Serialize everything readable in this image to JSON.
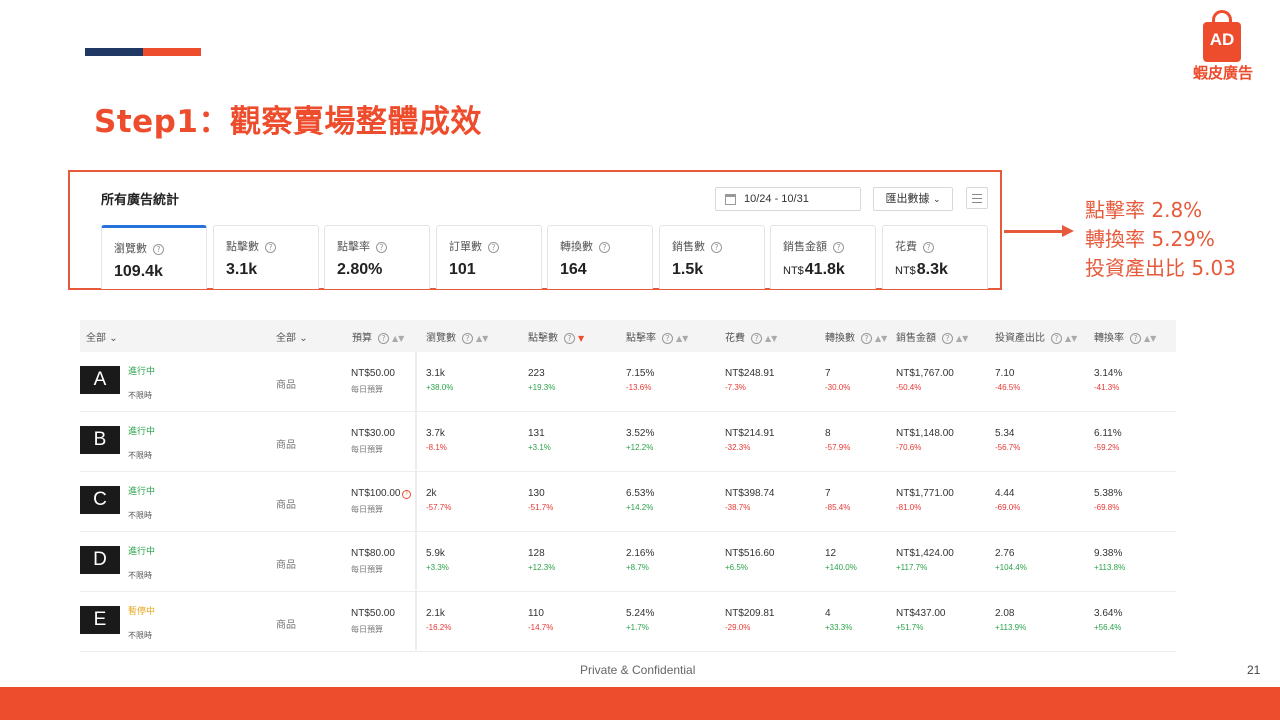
{
  "slide": {
    "title": "Step1：觀察賣場整體成效",
    "logo_ad": "AD",
    "logo_text": "蝦皮廣告",
    "footer": "Private & Confidential",
    "page": "21",
    "accent_color": "#ee4d2d",
    "navy_color": "#1f3864"
  },
  "stats": {
    "title": "所有廣告統計",
    "date_range": "10/24 - 10/31",
    "export_label": "匯出數據",
    "metrics": [
      {
        "label": "瀏覽數",
        "prefix": "",
        "value": "109.4k"
      },
      {
        "label": "點擊數",
        "prefix": "",
        "value": "3.1k"
      },
      {
        "label": "點擊率",
        "prefix": "",
        "value": "2.80%"
      },
      {
        "label": "訂單數",
        "prefix": "",
        "value": "101"
      },
      {
        "label": "轉換數",
        "prefix": "",
        "value": "164"
      },
      {
        "label": "銷售數",
        "prefix": "",
        "value": "1.5k"
      },
      {
        "label": "銷售金額",
        "prefix": "NT$",
        "value": "41.8k"
      },
      {
        "label": "花費",
        "prefix": "NT$",
        "value": "8.3k"
      }
    ]
  },
  "callout": {
    "line1": "點擊率 2.8%",
    "line2": "轉換率 5.29%",
    "line3": "投資產出比 5.03"
  },
  "table": {
    "headers": {
      "all1": "全部",
      "all2": "全部",
      "budget": "預算",
      "views": "瀏覽數",
      "clicks": "點擊數",
      "ctr": "點擊率",
      "spend": "花費",
      "conversions": "轉換數",
      "sales": "銷售金額",
      "roas": "投資產出比",
      "cvr": "轉換率"
    },
    "rows": [
      {
        "letter": "A",
        "status": "進行中",
        "duration": "不限時",
        "type": "商品",
        "budget": "NT$50.00",
        "budget_note": "每日預算",
        "views": "3.1k",
        "views_d": "+38.0%",
        "clicks": "223",
        "clicks_d": "+19.3%",
        "ctr": "7.15%",
        "ctr_d": "-13.6%",
        "spend": "NT$248.91",
        "spend_d": "-7.3%",
        "conv": "7",
        "conv_d": "-30.0%",
        "sales": "NT$1,767.00",
        "sales_d": "-50.4%",
        "roas": "7.10",
        "roas_d": "-46.5%",
        "cvr": "3.14%",
        "cvr_d": "-41.3%"
      },
      {
        "letter": "B",
        "status": "進行中",
        "duration": "不限時",
        "type": "商品",
        "budget": "NT$30.00",
        "budget_note": "每日預算",
        "views": "3.7k",
        "views_d": "-8.1%",
        "clicks": "131",
        "clicks_d": "+3.1%",
        "ctr": "3.52%",
        "ctr_d": "+12.2%",
        "spend": "NT$214.91",
        "spend_d": "-32.3%",
        "conv": "8",
        "conv_d": "-57.9%",
        "sales": "NT$1,148.00",
        "sales_d": "-70.6%",
        "roas": "5.34",
        "roas_d": "-56.7%",
        "cvr": "6.11%",
        "cvr_d": "-59.2%"
      },
      {
        "letter": "C",
        "status": "進行中",
        "duration": "不限時",
        "type": "商品",
        "budget": "NT$100.00",
        "budget_note": "每日預算",
        "views": "2k",
        "views_d": "-57.7%",
        "clicks": "130",
        "clicks_d": "-51.7%",
        "ctr": "6.53%",
        "ctr_d": "+14.2%",
        "spend": "NT$398.74",
        "spend_d": "-38.7%",
        "conv": "7",
        "conv_d": "-85.4%",
        "sales": "NT$1,771.00",
        "sales_d": "-81.0%",
        "roas": "4.44",
        "roas_d": "-69.0%",
        "cvr": "5.38%",
        "cvr_d": "-69.8%"
      },
      {
        "letter": "D",
        "status": "進行中",
        "duration": "不限時",
        "type": "商品",
        "budget": "NT$80.00",
        "budget_note": "每日預算",
        "views": "5.9k",
        "views_d": "+3.3%",
        "clicks": "128",
        "clicks_d": "+12.3%",
        "ctr": "2.16%",
        "ctr_d": "+8.7%",
        "spend": "NT$516.60",
        "spend_d": "+6.5%",
        "conv": "12",
        "conv_d": "+140.0%",
        "sales": "NT$1,424.00",
        "sales_d": "+117.7%",
        "roas": "2.76",
        "roas_d": "+104.4%",
        "cvr": "9.38%",
        "cvr_d": "+113.8%"
      },
      {
        "letter": "E",
        "status": "暫停中",
        "duration": "不限時",
        "type": "商品",
        "budget": "NT$50.00",
        "budget_note": "每日預算",
        "views": "2.1k",
        "views_d": "-16.2%",
        "clicks": "110",
        "clicks_d": "-14.7%",
        "ctr": "5.24%",
        "ctr_d": "+1.7%",
        "spend": "NT$209.81",
        "spend_d": "-29.0%",
        "conv": "4",
        "conv_d": "+33.3%",
        "sales": "NT$437.00",
        "sales_d": "+51.7%",
        "roas": "2.08",
        "roas_d": "+113.9%",
        "cvr": "3.64%",
        "cvr_d": "+56.4%"
      }
    ]
  }
}
